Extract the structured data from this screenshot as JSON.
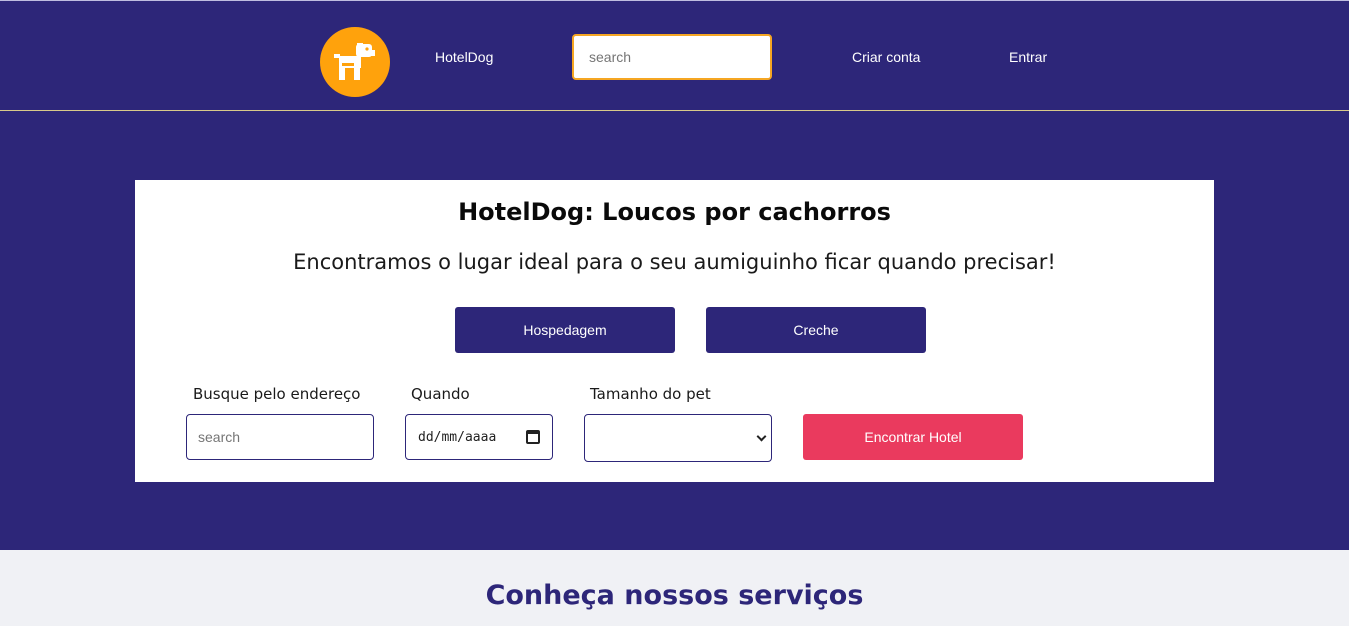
{
  "header": {
    "brand": "HotelDog",
    "search_placeholder": "search",
    "create_account": "Criar conta",
    "login": "Entrar"
  },
  "hero": {
    "title": "HotelDog: Loucos por cachorros",
    "subtitle": "Encontramos o lugar ideal para o seu aumiguinho ficar quando precisar!",
    "tabs": [
      {
        "label": "Hospedagem"
      },
      {
        "label": "Creche"
      }
    ],
    "form": {
      "address_label": "Busque pelo endereço",
      "address_placeholder": "search",
      "date_label": "Quando",
      "date_value": "dd/mm/aaaa",
      "size_label": "Tamanho do pet",
      "size_value": "",
      "submit_label": "Encontrar Hotel"
    }
  },
  "services": {
    "title": "Conheça nossos serviços"
  },
  "colors": {
    "primary": "#2d2679",
    "accent": "#ffa20c",
    "cta": "#ea3a5e",
    "background": "#f0f1f5"
  },
  "icons": {
    "logo": "dog-icon",
    "date": "calendar-icon",
    "select": "chevron-down-icon"
  }
}
